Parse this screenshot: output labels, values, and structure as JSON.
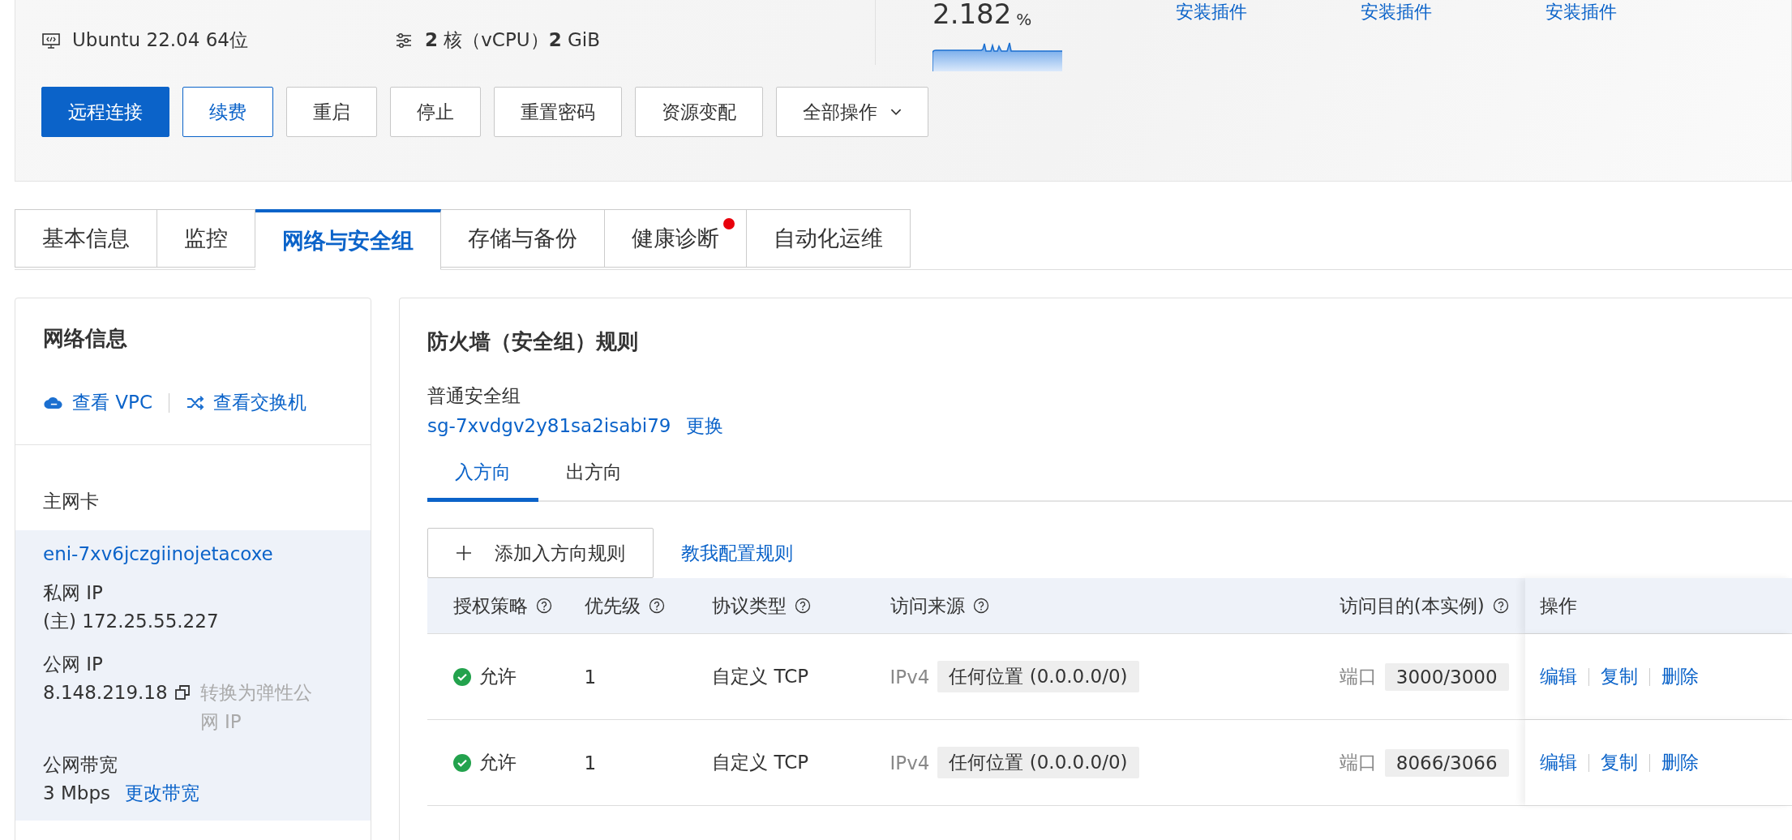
{
  "summary": {
    "os": "Ubuntu 22.04 64位",
    "spec": "**2** 核（vCPU）**2** GiB"
  },
  "metric": {
    "value": "2.182",
    "unit": "%"
  },
  "plugin_links": [
    "安装插件",
    "安装插件",
    "安装插件"
  ],
  "actions": [
    {
      "label": "远程连接",
      "kind": "primary"
    },
    {
      "label": "续费",
      "kind": "outline"
    },
    {
      "label": "重启",
      "kind": "default"
    },
    {
      "label": "停止",
      "kind": "default"
    },
    {
      "label": "重置密码",
      "kind": "default"
    },
    {
      "label": "资源变配",
      "kind": "default"
    },
    {
      "label": "全部操作",
      "kind": "dropdown"
    }
  ],
  "tabs": [
    {
      "label": "基本信息",
      "selected": false,
      "alert": false
    },
    {
      "label": "监控",
      "selected": false,
      "alert": false
    },
    {
      "label": "网络与安全组",
      "selected": true,
      "alert": false
    },
    {
      "label": "存储与备份",
      "selected": false,
      "alert": false
    },
    {
      "label": "健康诊断",
      "selected": false,
      "alert": true
    },
    {
      "label": "自动化运维",
      "selected": false,
      "alert": false
    }
  ],
  "network_info": {
    "title": "网络信息",
    "links": [
      {
        "label": "查看 VPC",
        "kind": "cloud"
      },
      {
        "label": "查看交换机",
        "kind": "shuffle"
      }
    ],
    "nic_section": "主网卡",
    "nic_id": "eni-7xv6jczgiinojetacoxe",
    "private_ip_label": "私网 IP",
    "private_ip": "(主) 172.25.55.227",
    "public_ip_label": "公网 IP",
    "public_ip": "8.148.219.18",
    "convert_link": {
      "label": "转换为弹性公网 IP",
      "disabled": true
    },
    "bandwidth_label": "公网带宽",
    "bandwidth": "3 Mbps",
    "change_bandwidth": "更改带宽"
  },
  "firewall": {
    "title": "防火墙（安全组）规则",
    "group_type": "普通安全组",
    "group_id": "sg-7xvdgv2y81sa2isabi79",
    "change_link": "更换",
    "direction_tabs": [
      {
        "label": "入方向",
        "selected": true
      },
      {
        "label": "出方向",
        "selected": false
      }
    ],
    "add_button": "添加入方向规则",
    "help_link": "教我配置规则",
    "table": {
      "columns": [
        {
          "label": "授权策略",
          "help": true
        },
        {
          "label": "优先级",
          "help": true
        },
        {
          "label": "协议类型",
          "help": true
        },
        {
          "label": "访问来源",
          "help": true
        },
        {
          "label": "访问目的(本实例)",
          "help": true
        },
        {
          "label": "操作",
          "help": false
        }
      ],
      "rows": [
        {
          "policy": "允许",
          "allowed": true,
          "priority": "1",
          "protocol": "自定义 TCP",
          "source_type": "IPv4",
          "source": "任何位置 (0.0.0.0/0)",
          "dest_label": "端口",
          "dest": "3000/3000",
          "actions": [
            "编辑",
            "复制",
            "删除"
          ]
        },
        {
          "policy": "允许",
          "allowed": true,
          "priority": "1",
          "protocol": "自定义 TCP",
          "source_type": "IPv4",
          "source": "任何位置 (0.0.0.0/0)",
          "dest_label": "端口",
          "dest": "8066/3066",
          "actions": [
            "编辑",
            "复制",
            "删除"
          ]
        }
      ]
    }
  }
}
